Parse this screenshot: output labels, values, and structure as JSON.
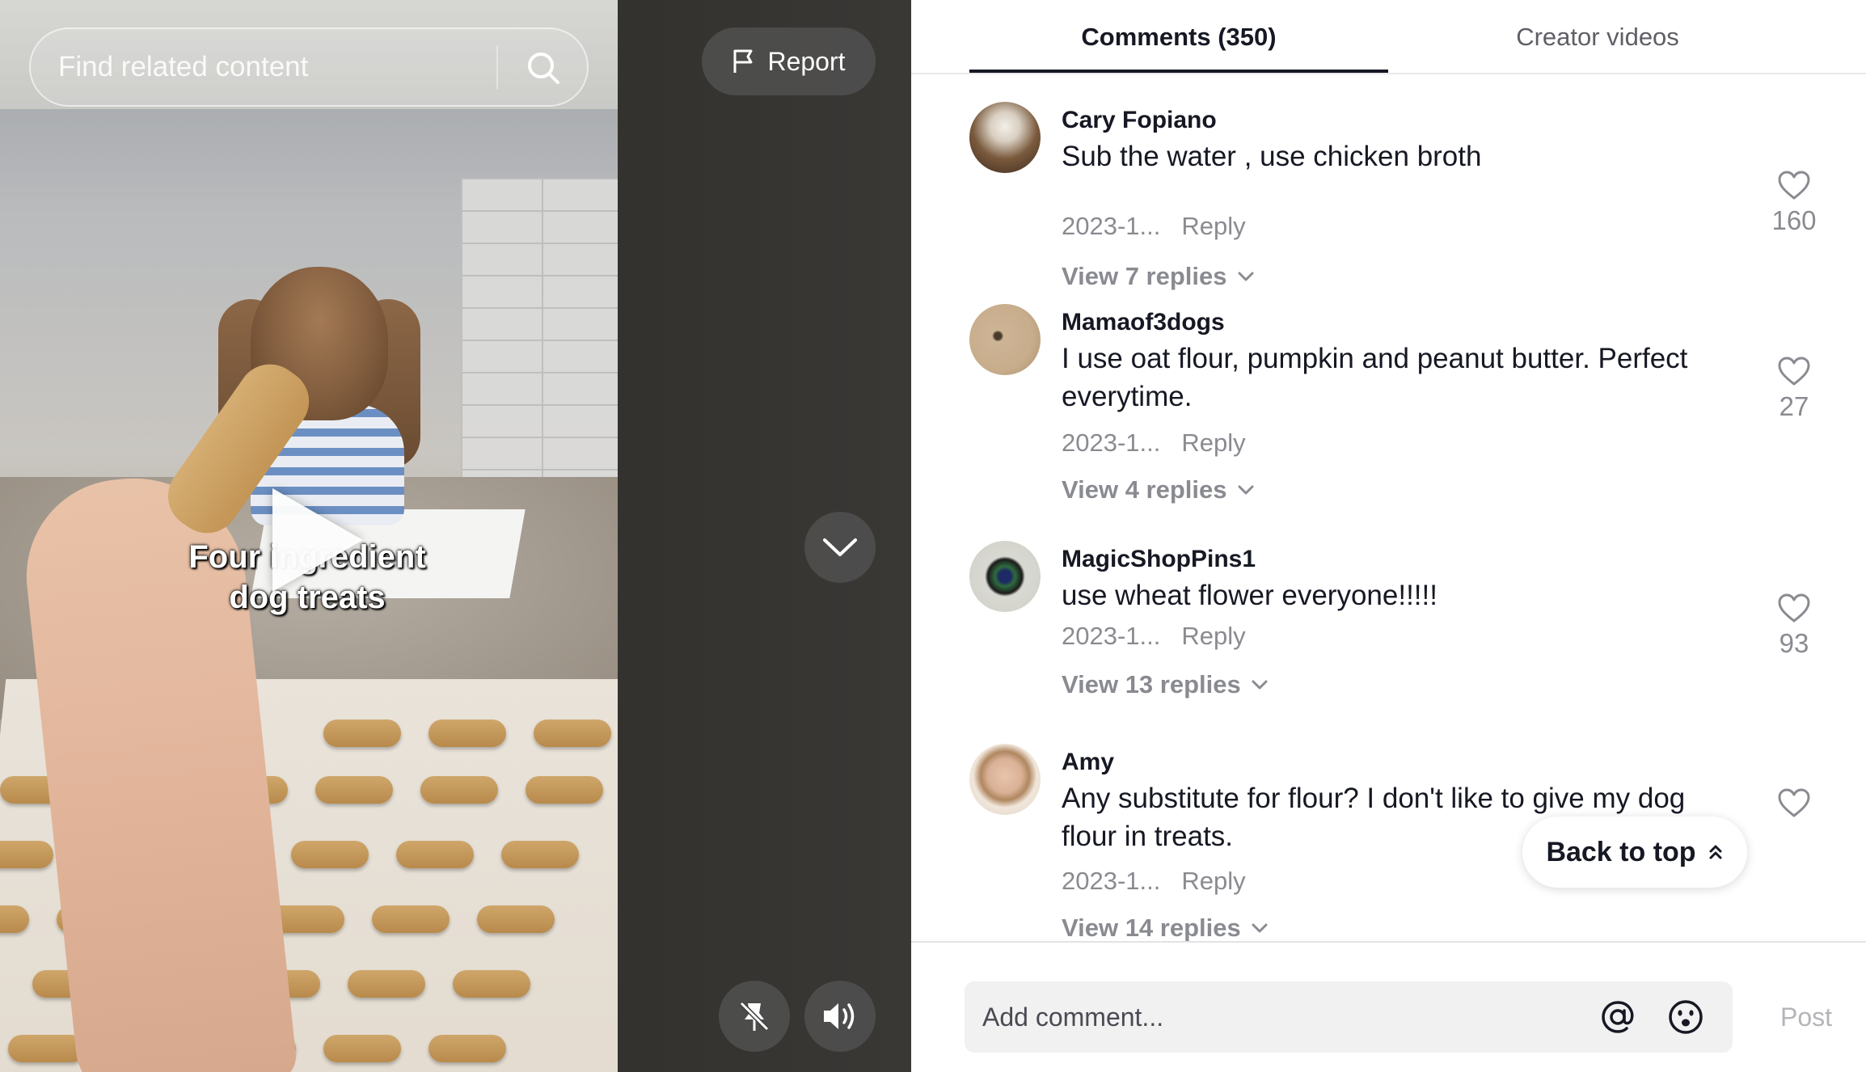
{
  "player": {
    "search_placeholder": "Find related content",
    "report_label": "Report",
    "caption_line1": "Four ingredient",
    "caption_line2": "dog treats"
  },
  "tabs": [
    {
      "label": "Comments (350)",
      "active": true
    },
    {
      "label": "Creator videos",
      "active": false
    }
  ],
  "comments": [
    {
      "user": "Cary Fopiano",
      "text": "Sub the water , use chicken broth",
      "date": "2023-1...",
      "reply_label": "Reply",
      "likes": "160",
      "view_replies": "View 7 replies"
    },
    {
      "user": "Mamaof3dogs",
      "text": "I use oat flour, pumpkin and peanut butter. Perfect everytime.",
      "date": "2023-1...",
      "reply_label": "Reply",
      "likes": "27",
      "view_replies": "View 4 replies"
    },
    {
      "user": "MagicShopPins1",
      "text": "use wheat flower everyone!!!!!",
      "date": "2023-1...",
      "reply_label": "Reply",
      "likes": "93",
      "view_replies": "View 13 replies"
    },
    {
      "user": "Amy",
      "text": "Any substitute for flour? I don't like to give my dog flour in treats.",
      "date": "2023-1...",
      "reply_label": "Reply",
      "likes": "",
      "view_replies": "View 14 replies"
    }
  ],
  "back_to_top_label": "Back to top",
  "footer": {
    "add_comment_placeholder": "Add comment...",
    "post_label": "Post"
  },
  "colors": {
    "text_primary": "#161823",
    "text_secondary": "#8a8b91",
    "post_disabled": "#b4b5b9"
  }
}
